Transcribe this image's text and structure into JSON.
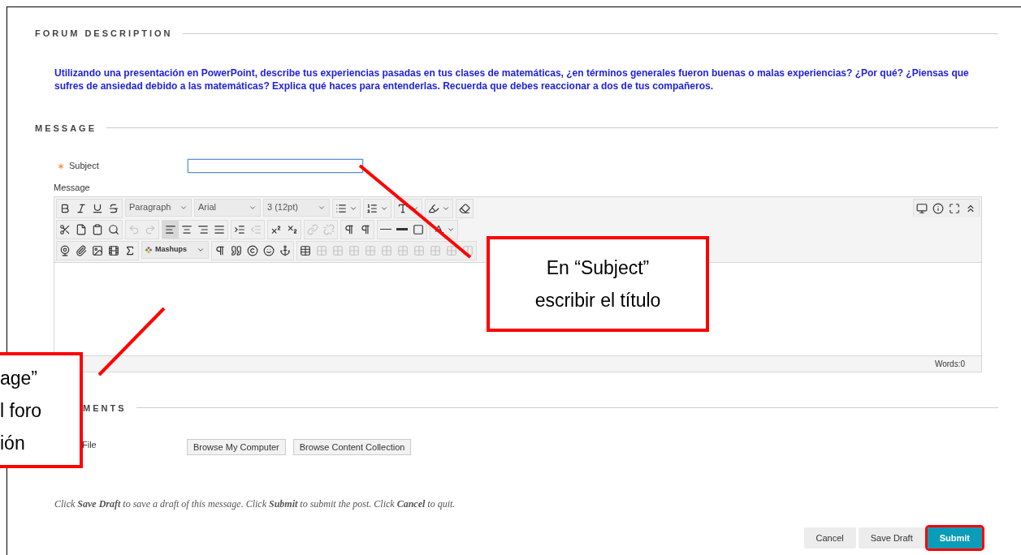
{
  "forum_description": {
    "heading": "FORUM DESCRIPTION",
    "text": "Utilizando una presentación en PowerPoint, describe tus experiencias pasadas en tus clases de matemáticas, ¿en términos generales fueron buenas o malas experiencias? ¿Por qué? ¿Piensas que sufres de ansiedad debido a las matemáticas? Explica qué haces para entenderlas. Recuerda que debes reaccionar a dos de tus compañeros."
  },
  "message": {
    "heading": "MESSAGE",
    "subject": {
      "label": "Subject",
      "required": true,
      "focused": true
    },
    "message_label": "Message",
    "editor": {
      "toolbar_rows": [
        [
          {
            "kind": "group",
            "items": [
              {
                "kind": "bold",
                "disabled": false,
                "pressed": false
              },
              {
                "kind": "italic",
                "disabled": false,
                "pressed": false
              },
              {
                "kind": "underline",
                "disabled": false,
                "pressed": false
              },
              {
                "kind": "strike",
                "disabled": false,
                "pressed": false
              }
            ]
          },
          {
            "kind": "select",
            "text": "Paragraph"
          },
          {
            "kind": "select",
            "text": "Arial"
          },
          {
            "kind": "select",
            "text": "3 (12pt)"
          },
          {
            "kind": "group",
            "items": [
              {
                "kind": "bullets",
                "disabled": false,
                "pressed": false,
                "caret": true
              }
            ]
          },
          {
            "kind": "group",
            "items": [
              {
                "kind": "numbers",
                "disabled": false,
                "pressed": false,
                "caret": true
              }
            ]
          },
          {
            "kind": "group",
            "items": [
              {
                "kind": "textcolor",
                "disabled": false,
                "pressed": false,
                "caret": true
              }
            ]
          },
          {
            "kind": "group",
            "items": [
              {
                "kind": "highlight",
                "disabled": false,
                "pressed": false,
                "caret": true
              }
            ]
          },
          {
            "kind": "group",
            "items": [
              {
                "kind": "eraser",
                "disabled": false,
                "pressed": false
              }
            ]
          }
        ],
        [
          {
            "kind": "group",
            "items": [
              {
                "kind": "cut",
                "disabled": false,
                "pressed": false
              },
              {
                "kind": "copy",
                "disabled": false,
                "pressed": false
              },
              {
                "kind": "paste",
                "disabled": false,
                "pressed": false
              },
              {
                "kind": "find",
                "disabled": false,
                "pressed": false
              }
            ]
          },
          {
            "kind": "group",
            "items": [
              {
                "kind": "undo",
                "disabled": true,
                "pressed": false
              },
              {
                "kind": "redo",
                "disabled": true,
                "pressed": false
              }
            ]
          },
          {
            "kind": "group",
            "items": [
              {
                "kind": "alignleft",
                "disabled": false,
                "pressed": true
              },
              {
                "kind": "aligncenter",
                "disabled": false,
                "pressed": false
              },
              {
                "kind": "alignright",
                "disabled": false,
                "pressed": false
              },
              {
                "kind": "justify",
                "disabled": false,
                "pressed": false
              }
            ]
          },
          {
            "kind": "group",
            "items": [
              {
                "kind": "indent",
                "disabled": false,
                "pressed": false
              },
              {
                "kind": "outdent",
                "disabled": true,
                "pressed": false
              }
            ]
          },
          {
            "kind": "group",
            "items": [
              {
                "kind": "superscript",
                "disabled": false,
                "pressed": false
              },
              {
                "kind": "subscript",
                "disabled": false,
                "pressed": false
              }
            ]
          },
          {
            "kind": "group",
            "items": [
              {
                "kind": "link",
                "disabled": true,
                "pressed": false
              },
              {
                "kind": "unlink",
                "disabled": true,
                "pressed": false
              }
            ]
          },
          {
            "kind": "group",
            "items": [
              {
                "kind": "ltr",
                "disabled": false,
                "pressed": false
              },
              {
                "kind": "rtl",
                "disabled": false,
                "pressed": false
              }
            ]
          },
          {
            "kind": "group",
            "items": [
              {
                "kind": "rule",
                "disabled": false,
                "pressed": false
              },
              {
                "kind": "thickrule",
                "disabled": false,
                "pressed": false
              },
              {
                "kind": "box",
                "disabled": false,
                "pressed": false
              }
            ]
          },
          {
            "kind": "group",
            "items": [
              {
                "kind": "spellcheck",
                "disabled": false,
                "pressed": false,
                "caret": true
              }
            ]
          }
        ],
        [
          {
            "kind": "group",
            "items": [
              {
                "kind": "webcam",
                "disabled": false,
                "pressed": false
              },
              {
                "kind": "attach",
                "disabled": false,
                "pressed": false
              },
              {
                "kind": "image",
                "disabled": false,
                "pressed": false
              },
              {
                "kind": "media",
                "disabled": false,
                "pressed": false
              },
              {
                "kind": "formula",
                "disabled": false,
                "pressed": false
              }
            ]
          },
          {
            "kind": "mashups",
            "text": "Mashups"
          },
          {
            "kind": "group",
            "items": [
              {
                "kind": "pilcrow",
                "disabled": false,
                "pressed": false
              },
              {
                "kind": "quote",
                "disabled": false,
                "pressed": false
              },
              {
                "kind": "copyright",
                "disabled": false,
                "pressed": false
              },
              {
                "kind": "smiley",
                "disabled": false,
                "pressed": false
              },
              {
                "kind": "anchor",
                "disabled": false,
                "pressed": false
              }
            ]
          },
          {
            "kind": "group",
            "items": [
              {
                "kind": "table",
                "disabled": false,
                "pressed": false
              },
              {
                "kind": "tablecell",
                "disabled": true,
                "pressed": false
              },
              {
                "kind": "tablecell",
                "disabled": true,
                "pressed": false
              },
              {
                "kind": "tablecell",
                "disabled": true,
                "pressed": false
              },
              {
                "kind": "tablecell",
                "disabled": true,
                "pressed": false
              },
              {
                "kind": "tablecell",
                "disabled": true,
                "pressed": false
              },
              {
                "kind": "tablecell",
                "disabled": true,
                "pressed": false
              },
              {
                "kind": "tablecell",
                "disabled": true,
                "pressed": false
              },
              {
                "kind": "tablecell",
                "disabled": true,
                "pressed": false
              },
              {
                "kind": "tablecell",
                "disabled": true,
                "pressed": false
              },
              {
                "kind": "split",
                "disabled": true,
                "pressed": false
              }
            ]
          }
        ]
      ],
      "right_tools": [
        {
          "kind": "preview",
          "disabled": false,
          "pressed": false
        },
        {
          "kind": "info",
          "disabled": false,
          "pressed": false
        },
        {
          "kind": "fullscreen",
          "disabled": false,
          "pressed": false
        },
        {
          "kind": "collapse",
          "disabled": false,
          "pressed": false
        }
      ],
      "words": "Words:0"
    }
  },
  "attachments": {
    "heading": "MENTS",
    "file_label": "File",
    "buttons": [
      "Browse My Computer",
      "Browse Content Collection"
    ]
  },
  "instructions": "Click **Save Draft** to save a draft of this message. Click **Submit** to submit the post. Click **Cancel** to quit.",
  "actions": [
    {
      "label": "Cancel",
      "primary": false,
      "highlighted": false
    },
    {
      "label": "Save Draft",
      "primary": false,
      "highlighted": false
    },
    {
      "label": "Submit",
      "primary": true,
      "highlighted": true
    }
  ],
  "callouts": [
    {
      "kind": "subject",
      "lines": [
        "En “Subject”",
        "escribir el título"
      ]
    },
    {
      "kind": "message",
      "lines": [
        "age”",
        "l foro",
        "ión"
      ]
    }
  ]
}
